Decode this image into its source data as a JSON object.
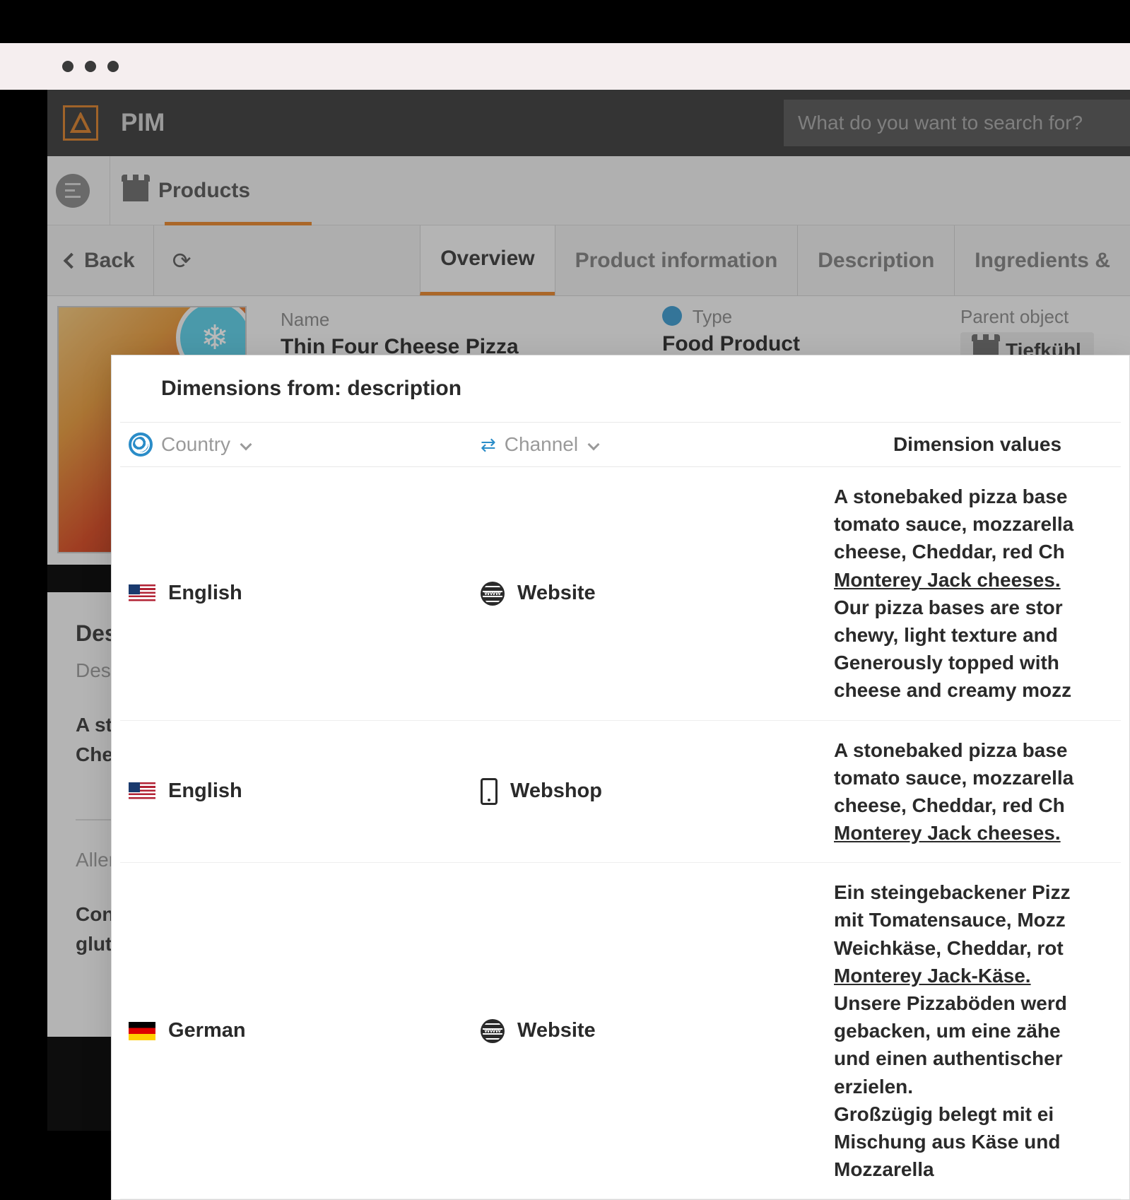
{
  "app": {
    "title": "PIM",
    "search_placeholder": "What do you want to search for?"
  },
  "breadcrumb": {
    "label": "Products"
  },
  "nav": {
    "back": "Back"
  },
  "tabs": {
    "overview": "Overview",
    "product_info": "Product information",
    "description": "Description",
    "ingredients": "Ingredients &"
  },
  "product": {
    "name_label": "Name",
    "name": "Thin Four Cheese Pizza",
    "type_label": "Type",
    "type": "Food Product",
    "parent_label": "Parent object",
    "parent_value": "Tiefkühl"
  },
  "desc_block": {
    "title": "Descript",
    "sub": "Descripti",
    "text_line1": "A stoneba",
    "text_line2": "Cheddar,",
    "allergy_label": "Allergy In",
    "allergy_line1": "Contains",
    "allergy_line2": "gluten, se"
  },
  "modal": {
    "title": "Dimensions from: description",
    "head_country": "Country",
    "head_channel": "Channel",
    "head_values": "Dimension values",
    "rows": [
      {
        "country": "English",
        "flag": "us",
        "channel": "Website",
        "channel_icon": "www",
        "value_plain": "A stonebaked pizza base\ntomato sauce, mozzarella\ncheese, Cheddar, red Ch",
        "value_under": "Monterey Jack cheeses.",
        "value_plain2": "Our pizza bases are stor\nchewy, light texture and\nGenerously topped with\ncheese and creamy mozz"
      },
      {
        "country": "English",
        "flag": "us",
        "channel": "Webshop",
        "channel_icon": "phone",
        "value_plain": "A stonebaked pizza base\ntomato sauce, mozzarella\ncheese, Cheddar, red Ch",
        "value_under": "Monterey Jack cheeses.",
        "value_plain2": ""
      },
      {
        "country": "German",
        "flag": "de",
        "channel": "Website",
        "channel_icon": "www",
        "value_plain": "Ein steingebackener Pizz\nmit Tomatensauce, Mozz\nWeichkäse, Cheddar, rot",
        "value_under": "Monterey Jack-Käse.",
        "value_plain2": "Unsere Pizzaböden werd\ngebacken, um eine zähe\nund einen authentischer\nerzielen.\nGroßzügig belegt mit ei\nMischung aus Käse und\nMozzarella"
      }
    ]
  }
}
